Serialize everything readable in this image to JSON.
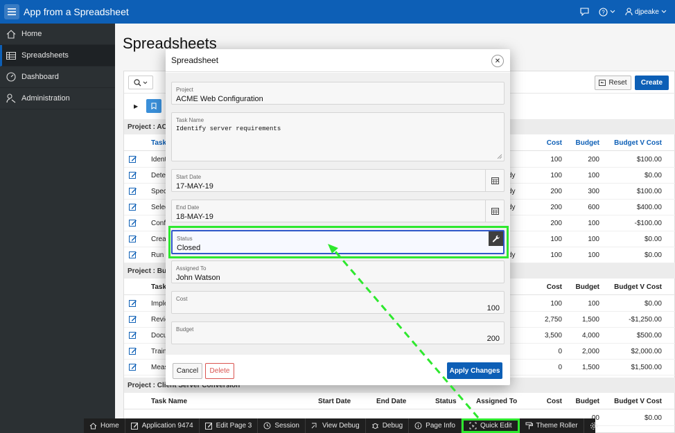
{
  "app": {
    "title": "App from a Spreadsheet",
    "user": "djpeake"
  },
  "sidebar": {
    "items": [
      {
        "label": "Home",
        "icon": "home-icon"
      },
      {
        "label": "Spreadsheets",
        "icon": "table-icon",
        "active": true
      },
      {
        "label": "Dashboard",
        "icon": "dashboard-icon"
      },
      {
        "label": "Administration",
        "icon": "wrench-user-icon"
      }
    ]
  },
  "page": {
    "title": "Spreadsheets"
  },
  "report": {
    "reset_label": "Reset",
    "create_label": "Create",
    "groups": [
      {
        "label": "Project : ACM"
      },
      {
        "label": "Project : Bug"
      },
      {
        "label": "Project : Client Server Conversion"
      }
    ],
    "header_labels": {
      "task": "Task",
      "cost": "Cost",
      "budget": "Budget",
      "budget_v_cost": "Budget V Cost",
      "start_date": "Start Date",
      "end_date": "End Date",
      "status": "Status",
      "assigned_to": "Assigned To",
      "task_name": "Task Name"
    },
    "group1_rows": [
      {
        "task": "Ident",
        "status": "",
        "cost": "100",
        "budget": "200",
        "bvc": "$100.00"
      },
      {
        "task": "Deter",
        "status": "dy",
        "cost": "100",
        "budget": "100",
        "bvc": "$0.00"
      },
      {
        "task": "Spec",
        "status": "dy",
        "cost": "200",
        "budget": "300",
        "bvc": "$100.00"
      },
      {
        "task": "Selec",
        "status": "dy",
        "cost": "200",
        "budget": "600",
        "bvc": "$400.00"
      },
      {
        "task": "Confi",
        "status": "",
        "cost": "200",
        "budget": "100",
        "bvc": "-$100.00"
      },
      {
        "task": "Creat",
        "status": "",
        "cost": "100",
        "budget": "100",
        "bvc": "$0.00"
      },
      {
        "task": "Run i",
        "status": "dy",
        "cost": "100",
        "budget": "100",
        "bvc": "$0.00"
      }
    ],
    "group2_rows": [
      {
        "task": "Imple",
        "cost": "100",
        "budget": "100",
        "bvc": "$0.00"
      },
      {
        "task": "Revie",
        "cost": "2,750",
        "budget": "1,500",
        "bvc": "-$1,250.00"
      },
      {
        "task": "Docu",
        "cost": "3,500",
        "budget": "4,000",
        "bvc": "$500.00"
      },
      {
        "task": "Train",
        "cost": "0",
        "budget": "2,000",
        "bvc": "$2,000.00"
      },
      {
        "task": "Meas",
        "cost": "0",
        "budget": "1,500",
        "bvc": "$1,500.00"
      }
    ],
    "group3_rows": [
      {
        "budget": "00",
        "bvc": "$0.00"
      }
    ]
  },
  "modal": {
    "title": "Spreadsheet",
    "fields": {
      "project": {
        "label": "Project",
        "value": "ACME Web Configuration"
      },
      "task_name": {
        "label": "Task Name",
        "value": "Identify server requirements"
      },
      "start_date": {
        "label": "Start Date",
        "value": "17-MAY-19"
      },
      "end_date": {
        "label": "End Date",
        "value": "18-MAY-19"
      },
      "status": {
        "label": "Status",
        "value": "Closed"
      },
      "assigned_to": {
        "label": "Assigned To",
        "value": "John Watson"
      },
      "cost": {
        "label": "Cost",
        "value": "100"
      },
      "budget": {
        "label": "Budget",
        "value": "200"
      }
    },
    "cancel_label": "Cancel",
    "delete_label": "Delete",
    "apply_label": "Apply Changes"
  },
  "devbar": {
    "items": [
      {
        "label": "Home",
        "icon": "home-icon"
      },
      {
        "label": "Application 9474",
        "icon": "edit-icon"
      },
      {
        "label": "Edit Page 3",
        "icon": "edit-icon"
      },
      {
        "label": "Session",
        "icon": "clock-icon"
      },
      {
        "label": "View Debug",
        "icon": "debug-view-icon"
      },
      {
        "label": "Debug",
        "icon": "bug-icon"
      },
      {
        "label": "Page Info",
        "icon": "info-icon"
      },
      {
        "label": "Quick Edit",
        "icon": "quick-edit-icon",
        "highlighted": true
      },
      {
        "label": "Theme Roller",
        "icon": "paint-roller-icon"
      }
    ]
  },
  "colors": {
    "brand": "#0d5fb6",
    "sidebar": "#2b3033",
    "highlight": "#2ee82e"
  }
}
